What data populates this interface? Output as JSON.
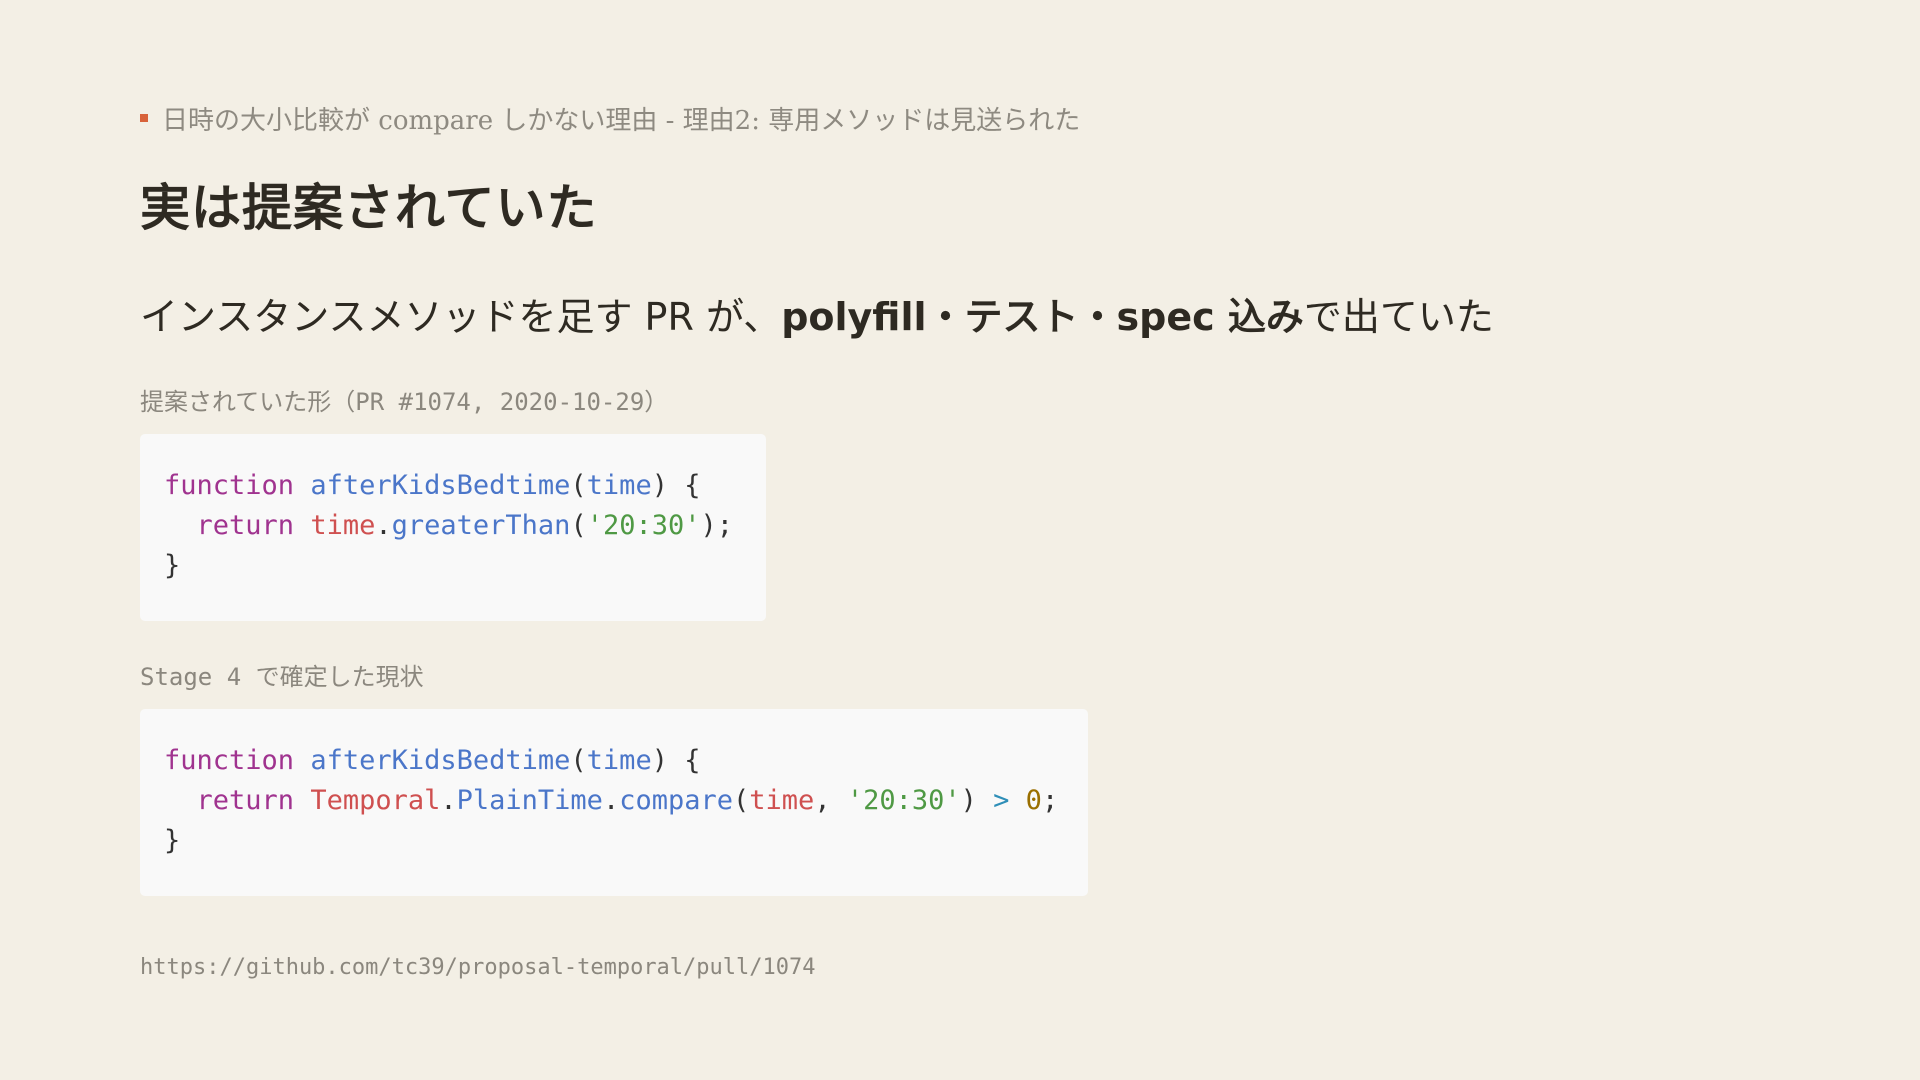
{
  "breadcrumb": {
    "text": "日時の大小比較が compare しかない理由 - 理由2: 専用メソッドは見送られた",
    "marker_color": "#d8623a"
  },
  "title": "実は提案されていた",
  "lead": {
    "prefix": "インスタンスメソッドを足す PR が、",
    "strong": "polyfill・テスト・spec 込み",
    "suffix": "で出ていた"
  },
  "proposal": {
    "caption": "提案されていた形（PR #1074, 2020-10-29）",
    "code": {
      "line1": {
        "keyword": "function",
        "name": "afterKidsBedtime",
        "open": "(",
        "param": "time",
        "close": ") {"
      },
      "line2": {
        "indent": "  ",
        "keyword": "return",
        "obj": "time",
        "dot": ".",
        "method": "greaterThan",
        "open": "(",
        "arg": "'20:30'",
        "close": ");"
      },
      "line3": "}"
    }
  },
  "current": {
    "caption": "Stage 4 で確定した現状",
    "code": {
      "line1": {
        "keyword": "function",
        "name": "afterKidsBedtime",
        "open": "(",
        "param": "time",
        "close": ") {"
      },
      "line2": {
        "indent": "  ",
        "keyword": "return",
        "ns": "Temporal",
        "dot1": ".",
        "cls": "PlainTime",
        "dot2": ".",
        "method": "compare",
        "open": "(",
        "arg1": "time",
        "comma": ", ",
        "arg2": "'20:30'",
        "close": ") ",
        "op": ">",
        "space": " ",
        "num": "0",
        "semi": ";"
      },
      "line3": "}"
    }
  },
  "footer": {
    "url": "https://github.com/tc39/proposal-temporal/pull/1074"
  },
  "colors": {
    "background": "#f3efe5",
    "code_background": "#f9f9f9",
    "keyword": "#a0338f",
    "function": "#4b76c9",
    "variable": "#cf5050",
    "string": "#4f9944",
    "number": "#9a6f00",
    "operator": "#2f8fb8"
  }
}
